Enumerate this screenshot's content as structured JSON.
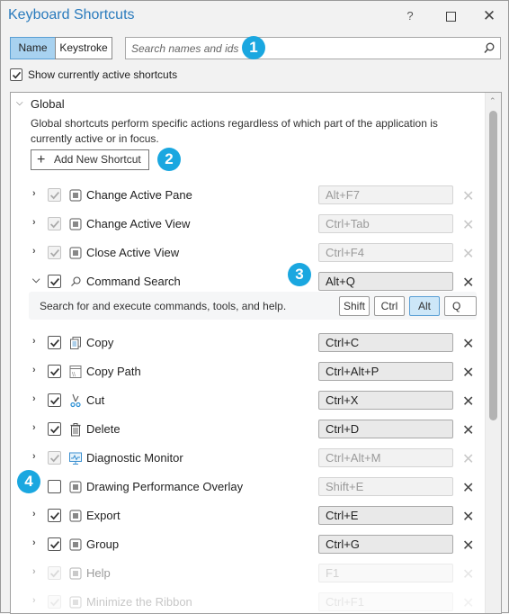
{
  "window": {
    "title": "Keyboard Shortcuts",
    "help_label": "?",
    "close_label": "✕"
  },
  "search_mode": {
    "name_label": "Name",
    "keystroke_label": "Keystroke",
    "selected": "Name"
  },
  "search": {
    "placeholder": "Search names and ids",
    "value": ""
  },
  "show_active": {
    "label": "Show currently active shortcuts",
    "checked": true
  },
  "callouts": [
    "1",
    "2",
    "3",
    "4"
  ],
  "group": {
    "name": "Global",
    "expanded": true,
    "description": "Global shortcuts perform specific actions regardless of which part of the application is currently active or in focus.",
    "add_button_label": "Add New Shortcut"
  },
  "commands": [
    {
      "name": "Change Active Pane",
      "keys": "Alt+F7",
      "checked": true,
      "state": "inactive",
      "icon": "command-square-icon",
      "expanded": false
    },
    {
      "name": "Change Active View",
      "keys": "Ctrl+Tab",
      "checked": true,
      "state": "inactive",
      "icon": "command-square-icon",
      "expanded": false
    },
    {
      "name": "Close Active View",
      "keys": "Ctrl+F4",
      "checked": true,
      "state": "inactive",
      "icon": "command-square-icon",
      "expanded": false
    },
    {
      "name": "Command Search",
      "keys": "Alt+Q",
      "checked": true,
      "state": "active",
      "icon": "search-icon",
      "expanded": true
    },
    {
      "name": "Copy",
      "keys": "Ctrl+C",
      "checked": true,
      "state": "active",
      "icon": "copy-icon",
      "expanded": false
    },
    {
      "name": "Copy Path",
      "keys": "Ctrl+Alt+P",
      "checked": true,
      "state": "active",
      "icon": "copy-path-icon",
      "expanded": false
    },
    {
      "name": "Cut",
      "keys": "Ctrl+X",
      "checked": true,
      "state": "active",
      "icon": "scissors-icon",
      "expanded": false
    },
    {
      "name": "Delete",
      "keys": "Ctrl+D",
      "checked": true,
      "state": "active",
      "icon": "trash-icon",
      "expanded": false
    },
    {
      "name": "Diagnostic Monitor",
      "keys": "Ctrl+Alt+M",
      "checked": true,
      "state": "inactive",
      "icon": "monitor-icon",
      "expanded": false
    },
    {
      "name": "Drawing Performance Overlay",
      "keys": "Shift+E",
      "checked": false,
      "state": "disabled-user",
      "icon": "command-square-icon",
      "expanded": false
    },
    {
      "name": "Export",
      "keys": "Ctrl+E",
      "checked": true,
      "state": "active",
      "icon": "command-square-icon",
      "expanded": false
    },
    {
      "name": "Group",
      "keys": "Ctrl+G",
      "checked": true,
      "state": "active",
      "icon": "command-square-icon",
      "expanded": false
    },
    {
      "name": "Help",
      "keys": "F1",
      "checked": true,
      "state": "inactive",
      "icon": "command-square-icon",
      "expanded": false
    },
    {
      "name": "Minimize the Ribbon",
      "keys": "Ctrl+F1",
      "checked": true,
      "state": "inactive",
      "icon": "command-square-icon",
      "expanded": false
    }
  ],
  "command_search_detail": {
    "description": "Search for and execute commands, tools, and help.",
    "modifiers": [
      {
        "label": "Shift",
        "on": false
      },
      {
        "label": "Ctrl",
        "on": false
      },
      {
        "label": "Alt",
        "on": true
      }
    ],
    "key": "Q"
  },
  "colors": {
    "accent": "#2a7bbd",
    "callout": "#1aa7e0",
    "selected_toggle": "#a8d2f0"
  }
}
